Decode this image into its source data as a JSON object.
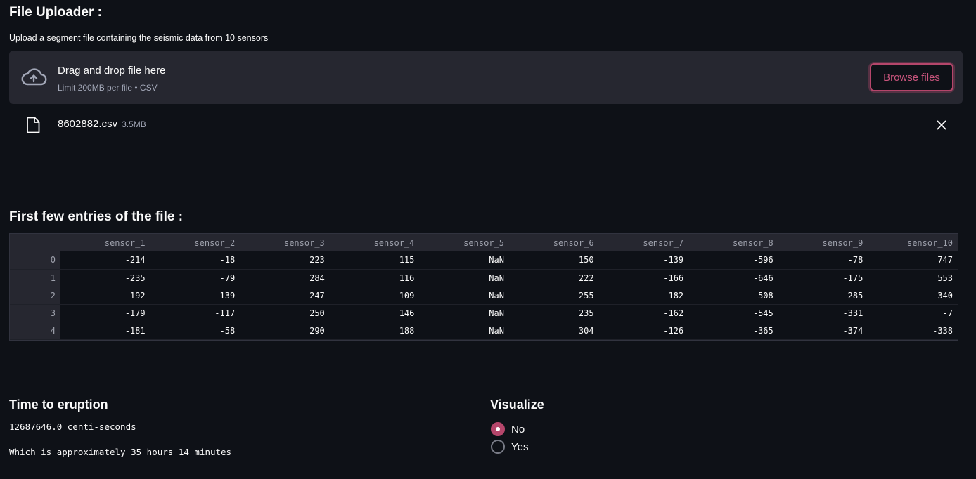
{
  "uploader": {
    "title": "File Uploader :",
    "label": "Upload a segment file containing the seismic data from 10 sensors",
    "drop_text": "Drag and drop file here",
    "limit_text": "Limit 200MB per file • CSV",
    "browse_label": "Browse files",
    "file": {
      "name": "8602882.csv",
      "size": "3.5MB"
    }
  },
  "table": {
    "title": "First few entries of the file :",
    "columns": [
      "",
      "sensor_1",
      "sensor_2",
      "sensor_3",
      "sensor_4",
      "sensor_5",
      "sensor_6",
      "sensor_7",
      "sensor_8",
      "sensor_9",
      "sensor_10"
    ],
    "rows": [
      [
        "0",
        "-214",
        "-18",
        "223",
        "115",
        "NaN",
        "150",
        "-139",
        "-596",
        "-78",
        "747"
      ],
      [
        "1",
        "-235",
        "-79",
        "284",
        "116",
        "NaN",
        "222",
        "-166",
        "-646",
        "-175",
        "553"
      ],
      [
        "2",
        "-192",
        "-139",
        "247",
        "109",
        "NaN",
        "255",
        "-182",
        "-508",
        "-285",
        "340"
      ],
      [
        "3",
        "-179",
        "-117",
        "250",
        "146",
        "NaN",
        "235",
        "-162",
        "-545",
        "-331",
        "-7"
      ],
      [
        "4",
        "-181",
        "-58",
        "290",
        "188",
        "NaN",
        "304",
        "-126",
        "-365",
        "-374",
        "-338"
      ]
    ]
  },
  "eruption": {
    "title": "Time to eruption",
    "value_line": "12687646.0 centi-seconds",
    "approx_line": "Which is approximately 35 hours 14 minutes"
  },
  "visualize": {
    "title": "Visualize",
    "options": [
      {
        "label": "No",
        "checked": true
      },
      {
        "label": "Yes",
        "checked": false
      }
    ]
  },
  "colors": {
    "background": "#0e1117",
    "panel": "#262730",
    "accent": "#b5466b"
  },
  "icons": {
    "upload": "cloud-upload-icon",
    "file": "file-icon",
    "remove": "close-icon"
  }
}
